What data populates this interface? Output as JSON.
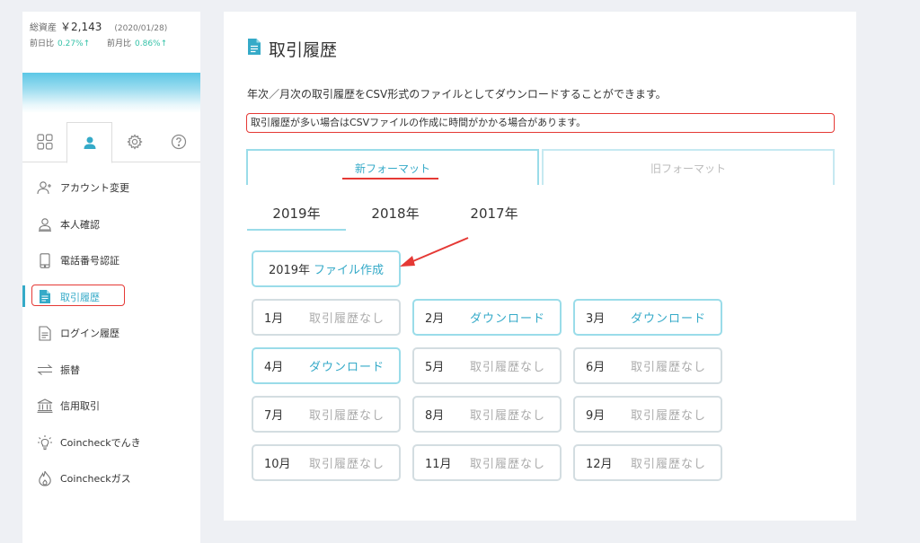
{
  "summary": {
    "total_label": "総資産",
    "total_value": "￥2,143",
    "date": "(2020/01/28)",
    "day_label": "前日比",
    "day_value": "0.27%↑",
    "month_label": "前月比",
    "month_value": "0.86%↑"
  },
  "sidebar": {
    "items": [
      {
        "label": "アカウント変更",
        "icon": "person-plus-icon"
      },
      {
        "label": "本人確認",
        "icon": "id-person-icon"
      },
      {
        "label": "電話番号認証",
        "icon": "phone-icon"
      },
      {
        "label": "取引履歴",
        "icon": "document-icon",
        "active": true
      },
      {
        "label": "ログイン履歴",
        "icon": "list-doc-icon"
      },
      {
        "label": "振替",
        "icon": "transfer-icon"
      },
      {
        "label": "信用取引",
        "icon": "bank-icon"
      },
      {
        "label": "Coincheckでんき",
        "icon": "lightbulb-icon"
      },
      {
        "label": "Coincheckガス",
        "icon": "flame-icon"
      }
    ]
  },
  "main": {
    "title": "取引履歴",
    "description": "年次／月次の取引履歴をCSV形式のファイルとしてダウンロードすることができます。",
    "warning": "取引履歴が多い場合はCSVファイルの作成に時間がかかる場合があります。",
    "format_tabs": [
      "新フォーマット",
      "旧フォーマット"
    ],
    "years": [
      "2019年",
      "2018年",
      "2017年"
    ],
    "create_year": "2019年",
    "create_label": "ファイル作成",
    "months": [
      {
        "month": "1月",
        "status": "取引履歴なし",
        "available": false
      },
      {
        "month": "2月",
        "status": "ダウンロード",
        "available": true
      },
      {
        "month": "3月",
        "status": "ダウンロード",
        "available": true
      },
      {
        "month": "4月",
        "status": "ダウンロード",
        "available": true
      },
      {
        "month": "5月",
        "status": "取引履歴なし",
        "available": false
      },
      {
        "month": "6月",
        "status": "取引履歴なし",
        "available": false
      },
      {
        "month": "7月",
        "status": "取引履歴なし",
        "available": false
      },
      {
        "month": "8月",
        "status": "取引履歴なし",
        "available": false
      },
      {
        "month": "9月",
        "status": "取引履歴なし",
        "available": false
      },
      {
        "month": "10月",
        "status": "取引履歴なし",
        "available": false
      },
      {
        "month": "11月",
        "status": "取引履歴なし",
        "available": false
      },
      {
        "month": "12月",
        "status": "取引履歴なし",
        "available": false
      }
    ]
  },
  "colors": {
    "accent": "#35aac8",
    "positive": "#35c2a8",
    "highlight": "#e53935",
    "border_active": "#9adce9"
  }
}
